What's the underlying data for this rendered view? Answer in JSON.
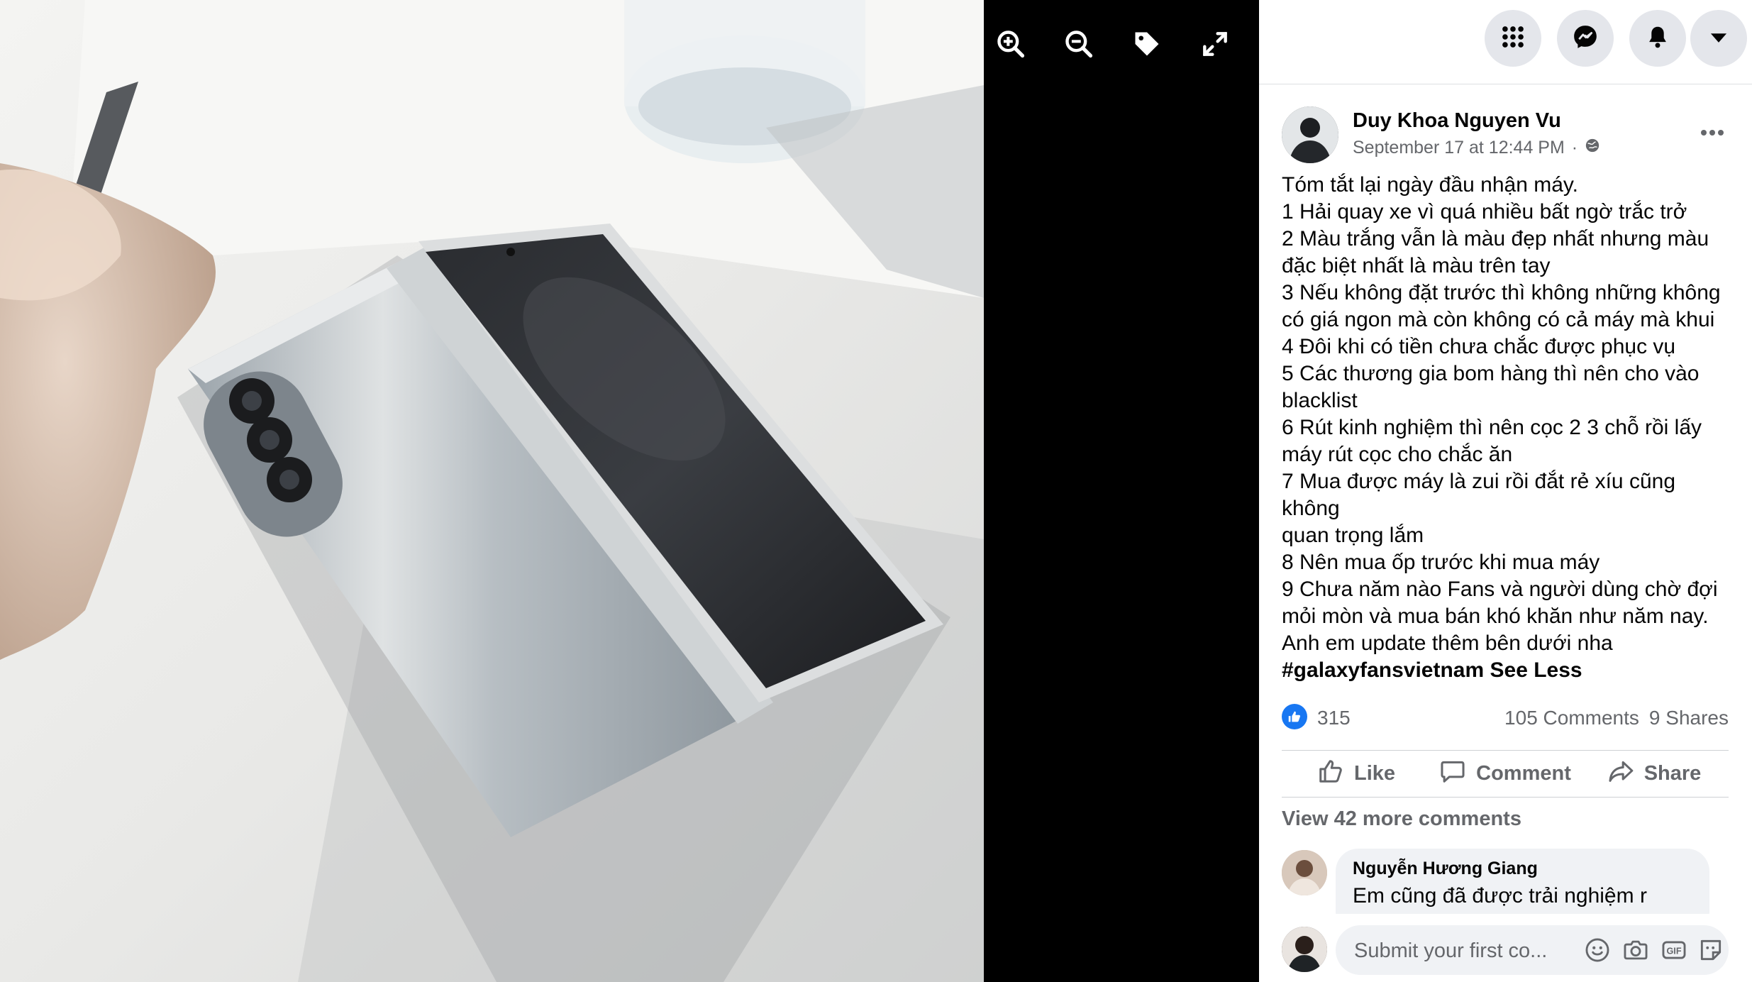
{
  "colors": {
    "accent": "#1877f2",
    "panel_bg": "#ffffff",
    "viewer_bg": "#000000",
    "secondary_text": "#65676b",
    "button_bg": "#e4e6eb"
  },
  "viewer": {
    "tools": [
      {
        "name": "zoom-in-icon"
      },
      {
        "name": "zoom-out-icon"
      },
      {
        "name": "tag-icon"
      },
      {
        "name": "fullscreen-icon"
      }
    ]
  },
  "topbar": {
    "buttons": [
      "menu-grid-icon",
      "messenger-icon",
      "notifications-icon",
      "account-dropdown-icon"
    ]
  },
  "post": {
    "author": "Duy Khoa Nguyen Vu",
    "timestamp": "September 17 at 12:44 PM",
    "privacy": "·",
    "privacy_icon": "globe-icon",
    "lines": [
      "Tóm tắt lại ngày đầu nhận máy.",
      "1 Hải quay xe vì quá nhiều bất ngờ trắc trở",
      "2 Màu trắng vẫn là màu đẹp nhất nhưng màu",
      "đặc biệt nhất là màu trên tay",
      "3 Nếu không đặt trước thì không những không",
      "có giá ngon mà còn không có cả máy mà khui",
      "4 Đôi khi có tiền chưa chắc được phục vụ",
      "5 Các thương gia bom hàng thì nên cho vào",
      "blacklist",
      "6 Rút kinh nghiệm thì nên cọc 2 3 chỗ rồi lấy",
      "máy rút cọc cho chắc ăn",
      "7 Mua được máy là zui rồi đắt rẻ xíu cũng không",
      "quan trọng lắm",
      "8 Nên mua ốp trước khi mua máy",
      "9 Chưa năm nào Fans và người dùng chờ đợi",
      "mỏi mòn và mua bán khó khăn như năm nay.",
      "Anh em update thêm bên dưới nha"
    ],
    "hashtag": "#galaxyfansvietnam",
    "see_less": "See Less"
  },
  "stats": {
    "likes": "315",
    "comments": "105 Comments",
    "shares": "9 Shares"
  },
  "actions": {
    "like": "Like",
    "comment": "Comment",
    "share": "Share"
  },
  "comments": {
    "view_more": "View 42 more comments",
    "first": {
      "name": "Nguyễn Hương Giang",
      "text": "Em cũng đã được trải nghiệm r"
    }
  },
  "composer": {
    "placeholder": "Submit your first co...",
    "icons": [
      "emoji-icon",
      "camera-icon",
      "gif-icon",
      "sticker-icon"
    ]
  }
}
